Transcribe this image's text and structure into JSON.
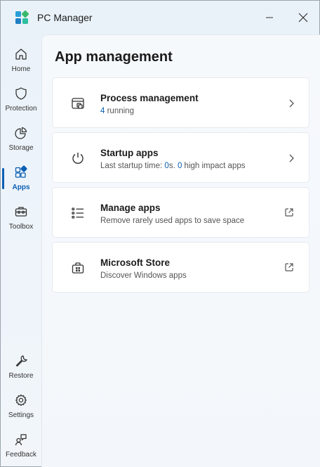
{
  "window": {
    "title": "PC Manager"
  },
  "sidebar": {
    "items": [
      {
        "label": "Home",
        "icon": "home-icon"
      },
      {
        "label": "Protection",
        "icon": "shield-icon"
      },
      {
        "label": "Storage",
        "icon": "pie-chart-icon"
      },
      {
        "label": "Apps",
        "icon": "apps-icon",
        "active": true
      },
      {
        "label": "Toolbox",
        "icon": "toolbox-icon"
      }
    ],
    "bottom_items": [
      {
        "label": "Restore",
        "icon": "wrench-icon"
      },
      {
        "label": "Settings",
        "icon": "gear-icon"
      },
      {
        "label": "Feedback",
        "icon": "feedback-icon"
      }
    ]
  },
  "main": {
    "title": "App management",
    "cards": [
      {
        "title": "Process management",
        "sub_num": "4",
        "sub_text": " running",
        "icon": "process-window-icon",
        "action": "chevron-right-icon"
      },
      {
        "title": "Startup apps",
        "sub_pre": "Last startup time: ",
        "sub_num1": "0",
        "sub_mid": "s. ",
        "sub_num2": "0",
        "sub_post": " high impact apps",
        "icon": "power-icon",
        "action": "chevron-right-icon"
      },
      {
        "title": "Manage apps",
        "sub_text": "Remove rarely used apps to save space",
        "icon": "list-icon",
        "action": "external-link-icon"
      },
      {
        "title": "Microsoft Store",
        "sub_text": "Discover Windows apps",
        "icon": "store-icon",
        "action": "external-link-icon"
      }
    ]
  },
  "colors": {
    "accent": "#0a5fb4",
    "background": "#eef4fa",
    "card": "#ffffff"
  }
}
